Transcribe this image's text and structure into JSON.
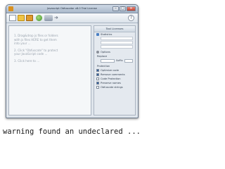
{
  "window": {
    "title": "Javascript Obfuscator v8.0 Trial License"
  },
  "toolbar": {
    "help_icon": "?"
  },
  "editor": {
    "lines": [
      "1. Drag&drop js files or folders",
      "with js files HERE to get them",
      "into your ... ",
      "2. Click \"Obfuscate\" to protect",
      "your JavaScript code ...",
      "3. Click here to ... "
    ]
  },
  "side_panel": {
    "header": "Tool Licenses",
    "statistics_label": "Statistics",
    "options_label": "Options",
    "replace_label": "Replace",
    "suffix_label": "Suffix",
    "protection_label": "Protection",
    "checkbox_items": [
      "Optimize code",
      "Remove comments",
      "Code Protection",
      "Preserve names",
      "Obfuscate strings"
    ]
  },
  "caption": {
    "text": "warning found an undeclared ..."
  }
}
